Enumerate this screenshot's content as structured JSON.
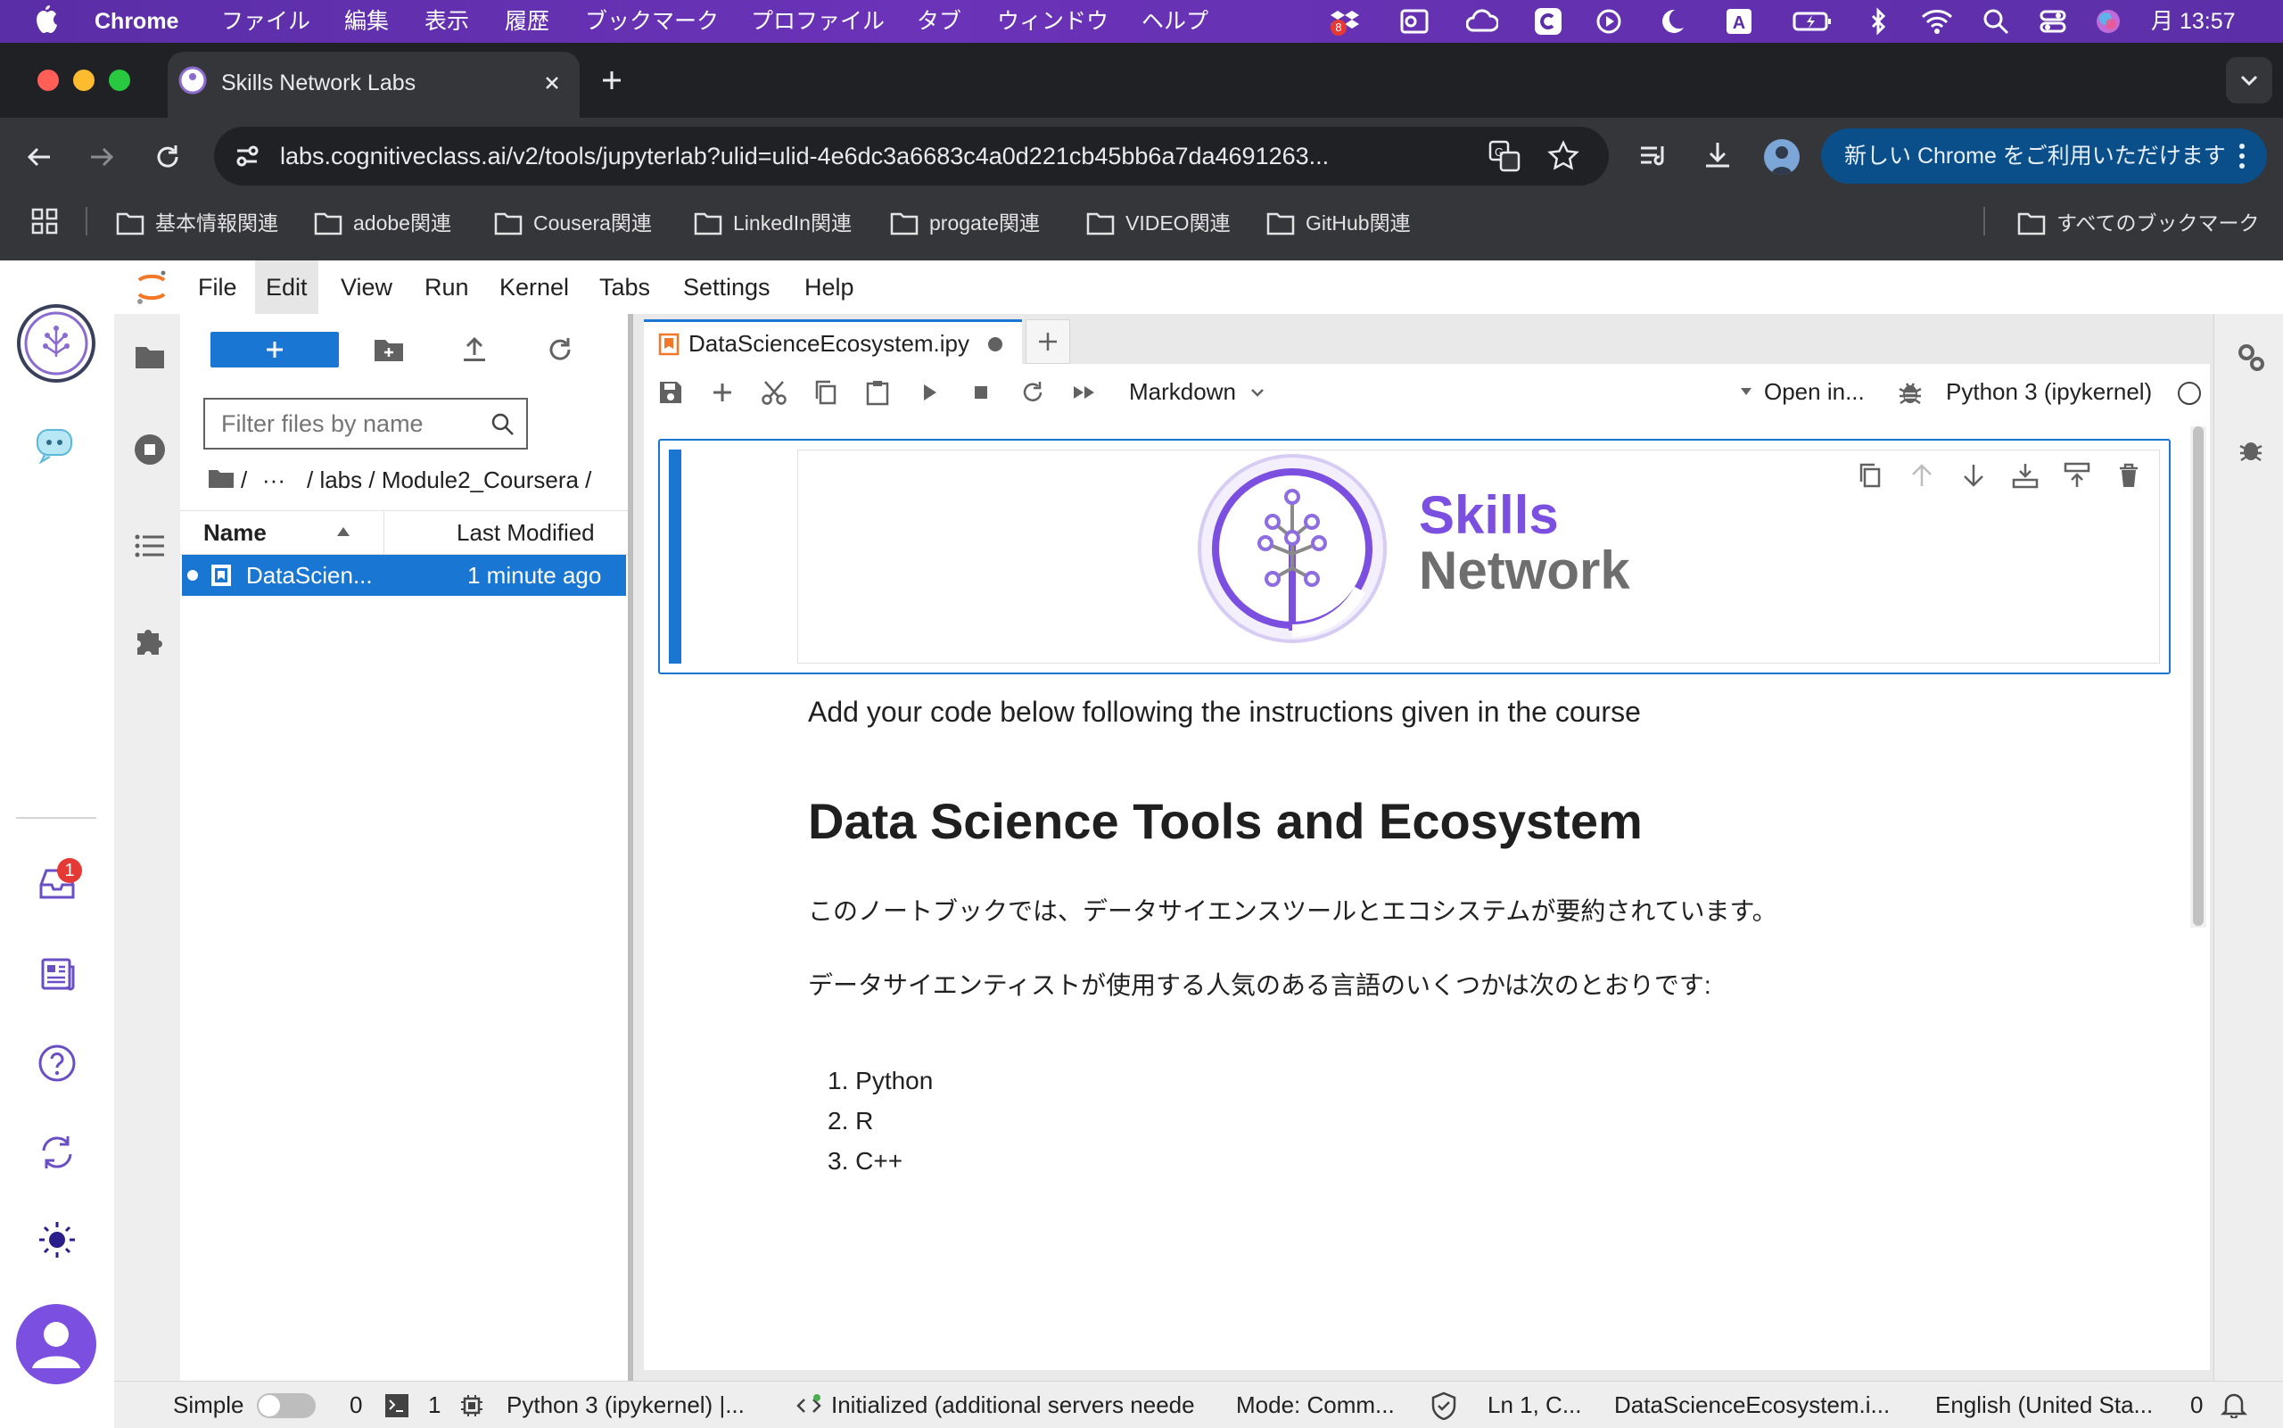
{
  "menubar": {
    "app": "Chrome",
    "items": [
      "ファイル",
      "編集",
      "表示",
      "履歴",
      "ブックマーク",
      "プロファイル",
      "タブ",
      "ウィンドウ",
      "ヘルプ"
    ],
    "clock": "月 13:57",
    "dropbox_badge": "8"
  },
  "chrome": {
    "tab_title": "Skills Network Labs",
    "url": "labs.cognitiveclass.ai/v2/tools/jupyterlab?ulid=ulid-4e6dc3a6683c4a0d221cb45bb6a7da4691263...",
    "update_button": "新しい Chrome をご利用いただけます",
    "bookmarks": [
      "基本情報関連",
      "adobe関連",
      "Cousera関連",
      "LinkedIn関連",
      "progate関連",
      "VIDEO関連",
      "GitHub関連"
    ],
    "all_bookmarks": "すべてのブックマーク"
  },
  "jupyter": {
    "menu": [
      "File",
      "Edit",
      "View",
      "Run",
      "Kernel",
      "Tabs",
      "Settings",
      "Help"
    ],
    "inbox_badge": "1",
    "filebrowser": {
      "filter_placeholder": "Filter files by name",
      "breadcrumb": "/ labs / Module2_Coursera /",
      "breadcrumb_root": "/",
      "breadcrumb_ellipsis": "···",
      "col_name": "Name",
      "col_modified": "Last Modified",
      "files": [
        {
          "name": "DataScien...",
          "modified": "1 minute ago"
        }
      ]
    },
    "notebook": {
      "tab_title": "DataScienceEcosystem.ipy",
      "cell_type": "Markdown",
      "open_in": "Open in...",
      "kernel": "Python 3 (ipykernel)",
      "logo_word1": "Skills",
      "logo_word2": "Network",
      "line1": "Add your code below following the instructions given in the course",
      "heading": "Data Science Tools and Ecosystem",
      "para1": "このノートブックでは、データサイエンスツールとエコシステムが要約されています。",
      "para2": "データサイエンティストが使用する人気のある言語のいくつかは次のとおりです:",
      "list": [
        "Python",
        "R",
        "C++"
      ]
    },
    "status": {
      "mode_label": "Simple",
      "count_a": "0",
      "count_b": "1",
      "kernel": "Python 3 (ipykernel) |...",
      "lsp": "Initialized (additional servers neede",
      "mode": "Mode: Comm...",
      "cursor": "Ln 1, C...",
      "file": "DataScienceEcosystem.i...",
      "language": "English (United Sta...",
      "notifications": "0"
    }
  },
  "colors": {
    "accent": "#1976d2",
    "skills_purple": "#7b4fe0",
    "network_gray": "#6e6e6e",
    "menubar_purple": "#5a2ea6"
  }
}
